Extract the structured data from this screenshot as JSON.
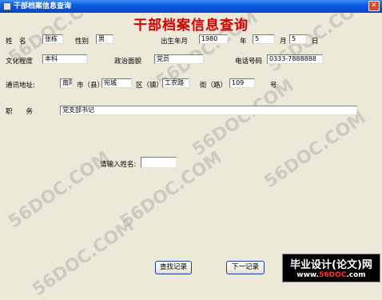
{
  "window": {
    "title": "干部档案信息查询",
    "close_glyph": "✕"
  },
  "heading": "干部档案信息查询",
  "form": {
    "name_label": "姓　名",
    "name_value": "张栋",
    "gender_label": "性别",
    "gender_value": "男",
    "birth_label": "出生年月",
    "birth_year": "1980",
    "year_label": "年",
    "birth_month": "5",
    "month_label": "月",
    "birth_day": "5",
    "day_label": "日",
    "education_label": "文化程度",
    "education_value": "本科",
    "politics_label": "政治面貌",
    "politics_value": "党员",
    "phone_label": "电话号码",
    "phone_value": "0333-7888888",
    "address_label": "通讯地址:",
    "address_value": "南阳",
    "city_label": "市（县）",
    "city_value": "宛城",
    "district_label": "区（镇）",
    "district_value": "工农路",
    "street_label": "街（路）",
    "street_value": "109",
    "number_label": "号",
    "position_label": "职　　务",
    "position_value": "党支部书记",
    "search_label": "请输入姓名:",
    "search_value": ""
  },
  "buttons": {
    "find": "查找记录",
    "next": "下一记录"
  },
  "watermarks": [
    "56DOC.COM",
    "56DOC.COM",
    "56DOC.COM",
    "56DOC.COM",
    "56DOC.COM",
    "56DOC.COM",
    "56DOC.COM",
    "56DOC.COM"
  ],
  "banner": {
    "title": "毕业设计(论文)网",
    "url_prefix": "www.",
    "url_accent": "56DOC",
    "url_suffix": ".com"
  }
}
